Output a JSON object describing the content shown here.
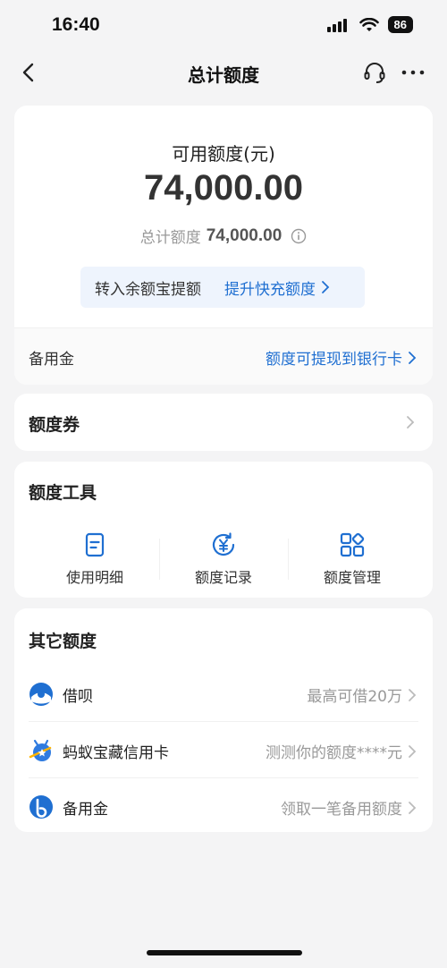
{
  "status": {
    "time": "16:40",
    "battery": "86"
  },
  "nav": {
    "title": "总计额度",
    "back_icon": "chevron-left-icon",
    "support_icon": "headset-icon",
    "more_icon": "more-dots-icon"
  },
  "summary": {
    "available_label": "可用额度(元)",
    "available_amount": "74,000.00",
    "total_label": "总计额度",
    "total_amount": "74,000.00",
    "promo_text": "转入余额宝提额",
    "promo_link": "提升快充额度",
    "reserve_label": "备用金",
    "reserve_link": "额度可提现到银行卡"
  },
  "coupon": {
    "label": "额度券"
  },
  "tools": {
    "title": "额度工具",
    "items": [
      {
        "label": "使用明细",
        "icon": "document-icon"
      },
      {
        "label": "额度记录",
        "icon": "yen-refresh-icon"
      },
      {
        "label": "额度管理",
        "icon": "grid-manage-icon"
      }
    ]
  },
  "other": {
    "title": "其它额度",
    "items": [
      {
        "name": "借呗",
        "desc": "最高可借20万",
        "icon": "jiebei-icon"
      },
      {
        "name": "蚂蚁宝藏信用卡",
        "desc": "测测你的额度****元",
        "icon": "ant-card-icon"
      },
      {
        "name": "备用金",
        "desc": "领取一笔备用额度",
        "icon": "reserve-b-icon"
      }
    ]
  },
  "colors": {
    "accent": "#1f6fd1",
    "background": "#f4f4f5",
    "muted": "#999999"
  }
}
